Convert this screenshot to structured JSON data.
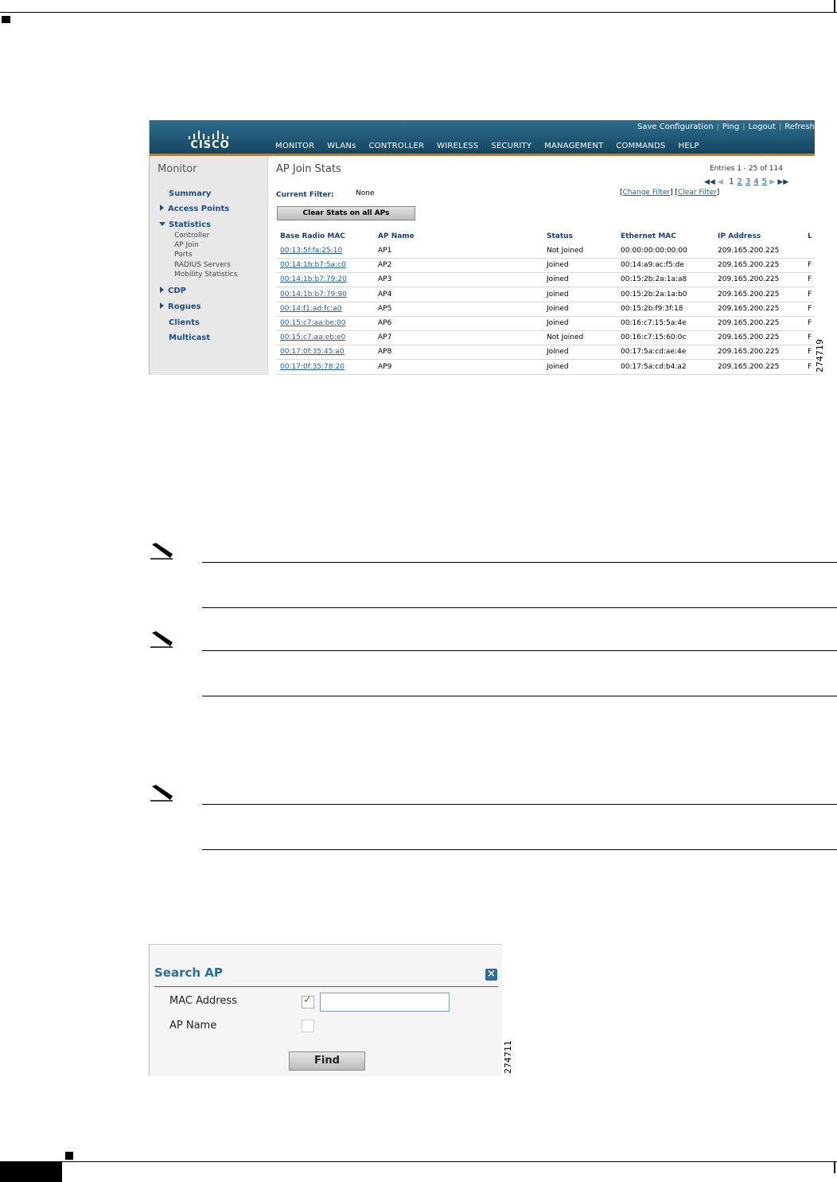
{
  "figure1": {
    "figure_id": "274719",
    "header": {
      "logo_text": "CISCO",
      "top_links": [
        "Save Configuration",
        "Ping",
        "Logout",
        "Refresh"
      ],
      "nav": [
        "MONITOR",
        "WLANs",
        "CONTROLLER",
        "WIRELESS",
        "SECURITY",
        "MANAGEMENT",
        "COMMANDS",
        "HELP"
      ]
    },
    "sidebar": {
      "title": "Monitor",
      "summary": "Summary",
      "access_points": "Access Points",
      "statistics": "Statistics",
      "statistics_sub": [
        "Controller",
        "AP Join",
        "Ports",
        "RADIUS Servers",
        "Mobility Statistics"
      ],
      "cdp": "CDP",
      "rogues": "Rogues",
      "clients": "Clients",
      "multicast": "Multicast"
    },
    "main": {
      "title": "AP Join Stats",
      "entries": "Entries 1 - 25 of 114",
      "pages": [
        "1",
        "2",
        "3",
        "4",
        "5"
      ],
      "current_filter_label": "Current Filter:",
      "current_filter_value": "None",
      "change_filter": "Change Filter",
      "clear_filter": "Clear Filter",
      "clear_stats_button": "Clear Stats on all APs"
    },
    "table": {
      "columns": [
        "Base Radio MAC",
        "AP Name",
        "Status",
        "Ethernet MAC",
        "IP Address",
        "L"
      ],
      "rows": [
        [
          "00:13:5f:fa:25:10",
          "AP1",
          "Not Joined",
          "00:00:00:00:00:00",
          "209.165.200.225",
          ""
        ],
        [
          "00:14:1b:b7:5a:c0",
          "AP2",
          "Joined",
          "00:14:a9:ac:f5:de",
          "209.165.200.225",
          "F"
        ],
        [
          "00:14:1b:b7:79:20",
          "AP3",
          "Joined",
          "00:15:2b:2a:1a:a8",
          "209.165.200.225",
          "F"
        ],
        [
          "00:14:1b:b7:79:90",
          "AP4",
          "Joined",
          "00:15:2b:2a:1a:b0",
          "209.165.200.225",
          "F"
        ],
        [
          "00:14:f1:ad:fc:a0",
          "AP5",
          "Joined",
          "00:15:2b:f9:3f:18",
          "209.165.200.225",
          "F"
        ],
        [
          "00:15:c7:aa:be:00",
          "AP6",
          "Joined",
          "00:16:c7:15:5a:4e",
          "209.165.200.225",
          "F"
        ],
        [
          "00:15:c7:aa:eb:e0",
          "AP7",
          "Not Joined",
          "00:16:c7:15:60:0c",
          "209.165.200.225",
          "F"
        ],
        [
          "00:17:0f:35:45:a0",
          "AP8",
          "Joined",
          "00:17:5a:cd:ae:4e",
          "209.165.200.225",
          "F"
        ],
        [
          "00:17:0f:35:78:20",
          "AP9",
          "Joined",
          "00:17:5a:cd:b4:a2",
          "209.165.200.225",
          "F"
        ]
      ]
    }
  },
  "figure2": {
    "figure_id": "274711",
    "title": "Search AP",
    "mac_label": "MAC Address",
    "mac_checked": true,
    "mac_value": "",
    "apname_label": "AP Name",
    "apname_checked": false,
    "find_button": "Find"
  }
}
